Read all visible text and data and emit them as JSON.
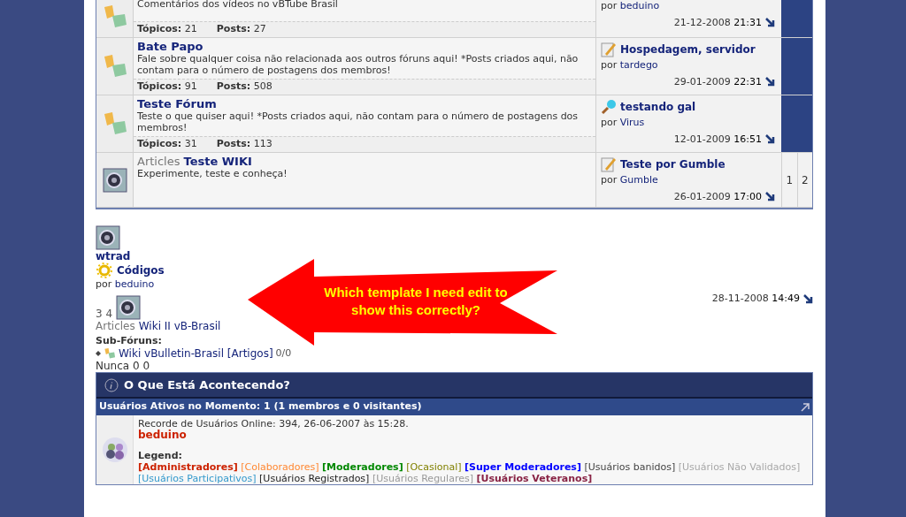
{
  "forums": [
    {
      "kind": "forum",
      "description": "Comentários dos vídeos no vBTube Brasil",
      "stats": [
        {
          "label": "Tópicos:",
          "value": "21"
        },
        {
          "label": "Posts:",
          "value": "27"
        }
      ],
      "last_post": {
        "by": "por",
        "user": "beduino",
        "date": "21-12-2008",
        "time": "21:31"
      }
    },
    {
      "kind": "forum",
      "title": "Bate Papo",
      "description": "Fale sobre qualquer coisa não relacionada aos outros fóruns aqui! *Posts criados aqui, não contam para o número de postagens dos membros!",
      "stats": [
        {
          "label": "Tópicos:",
          "value": "91"
        },
        {
          "label": "Posts:",
          "value": "508"
        }
      ],
      "last_post": {
        "title": "Hospedagem, servidor",
        "by": "por",
        "user": "tardego",
        "date": "29-01-2009",
        "time": "22:31"
      }
    },
    {
      "kind": "forum",
      "title": "Teste Fórum",
      "description": "Teste o que quiser aqui! *Posts criados aqui, não contam para o número de postagens dos membros!",
      "stats": [
        {
          "label": "Tópicos:",
          "value": "31"
        },
        {
          "label": "Posts:",
          "value": "113"
        }
      ],
      "last_post": {
        "title": "testando gal",
        "by": "por",
        "user": "Virus",
        "date": "12-01-2009",
        "time": "16:51"
      }
    },
    {
      "kind": "article",
      "prefix": "Articles",
      "title": "Teste WIKI",
      "description": "Experimente, teste e conheça!",
      "last_post": {
        "title": "Teste por Gumble",
        "by": "por",
        "user": "Gumble",
        "date": "26-01-2009",
        "time": "17:00"
      },
      "pages": [
        "1",
        "2"
      ]
    }
  ],
  "broken": {
    "name": "wtrad",
    "post_title": "Códigos",
    "by": "por",
    "user": "beduino",
    "date": "28-11-2008",
    "time": "14:49",
    "pages": "3 4",
    "prefix": "Articles",
    "forum": "Wiki II vB-Brasil",
    "subforums_label": "Sub-Fóruns:",
    "subforum": "Wiki vBulletin-Brasil [Artigos]",
    "subforum_counts": "0/0",
    "never": "Nunca 0 0"
  },
  "callout": {
    "text": "Which template I need edit to show this correctly?"
  },
  "whats_going_on": {
    "title": "O Que Está Acontecendo?",
    "active_users": "Usuários Ativos no Momento: 1 (1 membros e 0 visitantes)",
    "record": "Recorde de Usuários Online: 394, 26-06-2007 às 15:28.",
    "online_user": "beduino",
    "legend_label": "Legend:",
    "legend": [
      {
        "label": "[Administradores]",
        "color": "#cc2200",
        "bold": true
      },
      {
        "label": "[Colaboradores]",
        "color": "#ff8833",
        "bold": false
      },
      {
        "label": "[Moderadores]",
        "color": "#008800",
        "bold": true
      },
      {
        "label": "[Ocasional]",
        "color": "#808000",
        "bold": false
      },
      {
        "label": "[Super Moderadores]",
        "color": "#0000ff",
        "bold": true
      },
      {
        "label": "[Usuários banidos]",
        "color": "#444444",
        "bold": false
      },
      {
        "label": "[Usuários Não Validados]",
        "color": "#a8a8a8",
        "bold": false
      },
      {
        "label": "[Usuários Participativos]",
        "color": "#3399cc",
        "bold": false
      },
      {
        "label": "[Usuários Registrados]",
        "color": "#222222",
        "bold": false
      },
      {
        "label": "[Usuários Regulares]",
        "color": "#999999",
        "bold": false
      },
      {
        "label": "[Usuários Veteranos]",
        "color": "#882244",
        "bold": true
      }
    ]
  }
}
